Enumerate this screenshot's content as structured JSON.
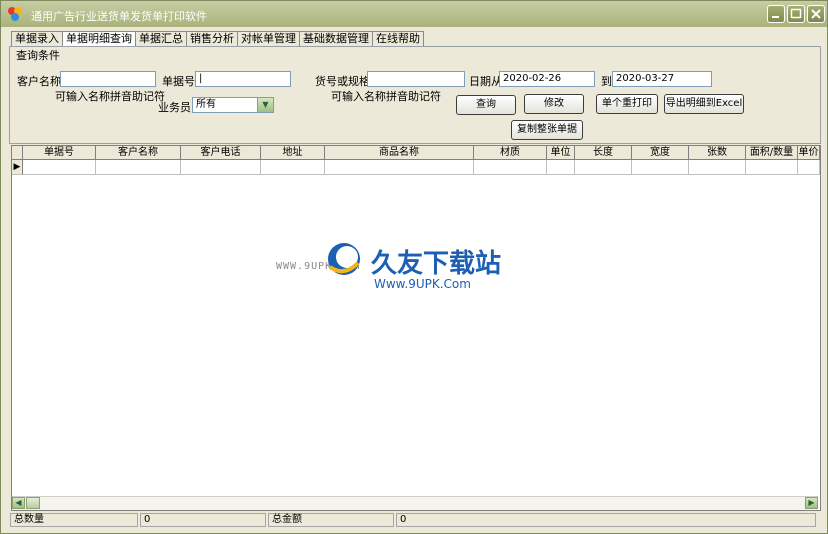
{
  "window": {
    "title": "通用广告行业送货单发货单打印软件",
    "colors": {
      "titlebar": "#a9b27a",
      "face": "#ece9d8"
    }
  },
  "tabs": [
    {
      "label": "单据录入",
      "active": false
    },
    {
      "label": "单据明细查询",
      "active": true
    },
    {
      "label": "单据汇总",
      "active": false
    },
    {
      "label": "销售分析",
      "active": false
    },
    {
      "label": "对帐单管理",
      "active": false
    },
    {
      "label": "基础数据管理",
      "active": false
    },
    {
      "label": "在线帮助",
      "active": false
    }
  ],
  "query": {
    "group_label": "查询条件",
    "customer_label": "客户名称",
    "customer_value": "",
    "customer_hint": "可输入名称拼音助记符",
    "docno_label": "单据号",
    "docno_value": "|",
    "spec_label": "货号或规格",
    "spec_value": "",
    "spec_hint": "可输入名称拼音助记符",
    "date_from_label": "日期从",
    "date_from": "2020-02-26",
    "date_to_label": "到",
    "date_to": "2020-03-27",
    "salesman_label": "业务员",
    "salesman_value": "所有"
  },
  "buttons": {
    "query": "查询",
    "modify": "修改",
    "print_one": "单个重打印",
    "export": "导出明细到Excel",
    "copy": "复制整张单据"
  },
  "grid": {
    "columns": [
      "单据号",
      "客户名称",
      "客户电话",
      "地址",
      "商品名称",
      "材质",
      "单位",
      "长度",
      "宽度",
      "张数",
      "面积/数量",
      "单价"
    ],
    "row_marker": "▶"
  },
  "status": {
    "total_qty_label": "总数量",
    "total_qty": "0",
    "total_amount_label": "总金额",
    "total_amount": "0"
  },
  "watermark": {
    "small": "WWW.9UPK.COM",
    "big": "久友下载站",
    "url": "Www.9UPK.Com"
  }
}
